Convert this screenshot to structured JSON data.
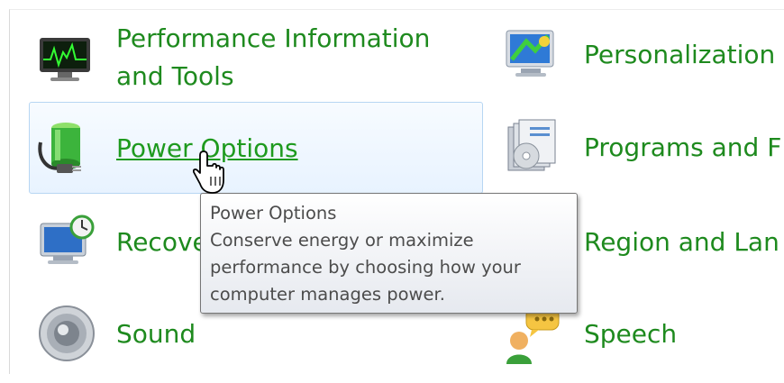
{
  "items": [
    {
      "label_line1": "Performance Information",
      "label_line2": "and Tools",
      "icon": "performance-monitor-icon"
    },
    {
      "label": "Personalization",
      "icon": "personalization-icon"
    },
    {
      "label": "Power Options",
      "icon": "power-options-battery-icon"
    },
    {
      "label": "Programs and F",
      "icon": "programs-features-icon"
    },
    {
      "label": "Recove",
      "icon": "recovery-icon"
    },
    {
      "label": "Region and Lan",
      "icon": "region-language-icon"
    },
    {
      "label": "Sound",
      "icon": "sound-speaker-icon"
    },
    {
      "label": "Speech",
      "icon": "speech-icon"
    }
  ],
  "tooltip": {
    "title": "Power Options",
    "line1": "Conserve energy or maximize",
    "line2": "performance by choosing how your",
    "line3": "computer manages power."
  },
  "colors": {
    "link_green": "#1e8a1e",
    "hover_border": "#b7d6f3",
    "tooltip_text": "#4c4c4c"
  },
  "cursor": "hand-pointer-cursor"
}
